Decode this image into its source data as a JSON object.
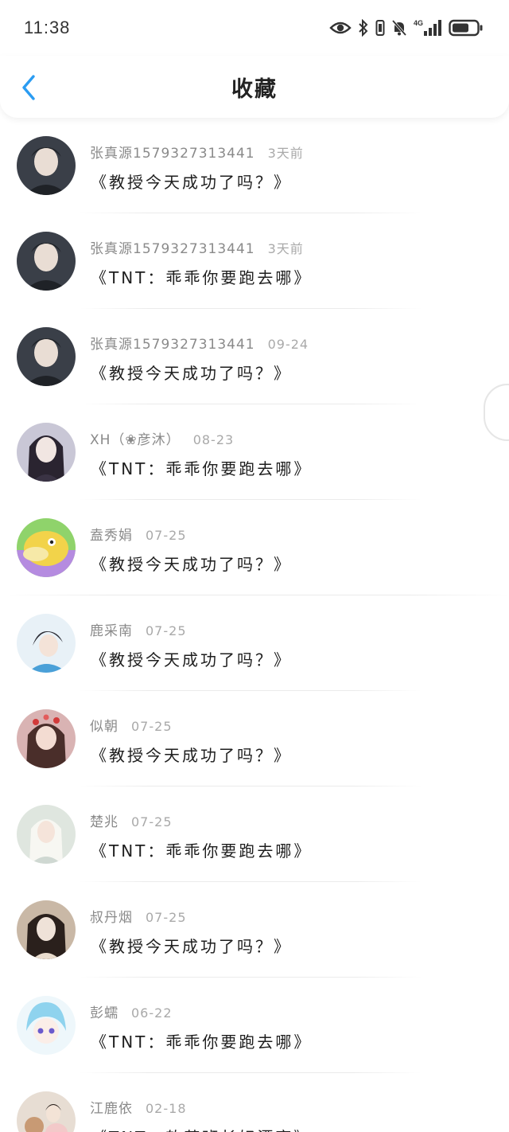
{
  "status_bar": {
    "time": "11:38",
    "network": "4G"
  },
  "header": {
    "title": "收藏"
  },
  "favorites": [
    {
      "author": "张真源1579327313441",
      "time": "3天前",
      "title": "《教授今天成功了吗？》",
      "avatar": {
        "bg": "#3a3f48",
        "fg": "#e9ddd4"
      }
    },
    {
      "author": "张真源1579327313441",
      "time": "3天前",
      "title": "《TNT：乖乖你要跑去哪》",
      "avatar": {
        "bg": "#3a3f48",
        "fg": "#e9ddd4"
      }
    },
    {
      "author": "张真源1579327313441",
      "time": "09-24",
      "title": "《教授今天成功了吗？》",
      "avatar": {
        "bg": "#3a3f48",
        "fg": "#e9ddd4"
      }
    },
    {
      "author": "XH（❀彦沐）",
      "time": "08-23",
      "title": "《TNT：乖乖你要跑去哪》",
      "avatar": {
        "bg": "#c9c7d6",
        "fg": "#f1e6e2"
      }
    },
    {
      "author": "盍秀娟",
      "time": "07-25",
      "title": "《教授今天成功了吗？》",
      "avatar": {
        "bg": "#8fd36b",
        "fg": "#f2d34a"
      }
    },
    {
      "author": "鹿采南",
      "time": "07-25",
      "title": "《教授今天成功了吗？》",
      "avatar": {
        "bg": "#e8f1f7",
        "fg": "#4aa0d8"
      }
    },
    {
      "author": "似朝",
      "time": "07-25",
      "title": "《教授今天成功了吗？》",
      "avatar": {
        "bg": "#d9b3b3",
        "fg": "#f3dcd2"
      }
    },
    {
      "author": "楚兆",
      "time": "07-25",
      "title": "《TNT：乖乖你要跑去哪》",
      "avatar": {
        "bg": "#dfe6df",
        "fg": "#f7f7f2"
      }
    },
    {
      "author": "叔丹烟",
      "time": "07-25",
      "title": "《教授今天成功了吗？》",
      "avatar": {
        "bg": "#c9b8a6",
        "fg": "#efe2d8"
      }
    },
    {
      "author": "彭蠕",
      "time": "06-22",
      "title": "《TNT：乖乖你要跑去哪》",
      "avatar": {
        "bg": "#eef7fb",
        "fg": "#8fd3ee"
      }
    },
    {
      "author": "江鹿依",
      "time": "02-18",
      "title": "《TNT：软萌班长好漂亮》",
      "avatar": {
        "bg": "#e7ddd3",
        "fg": "#c89a74"
      }
    }
  ],
  "colors": {
    "accent": "#2b9cf2",
    "text_primary": "#1e1e1e",
    "text_secondary": "#8a8a8a",
    "divider": "#ebebeb"
  }
}
